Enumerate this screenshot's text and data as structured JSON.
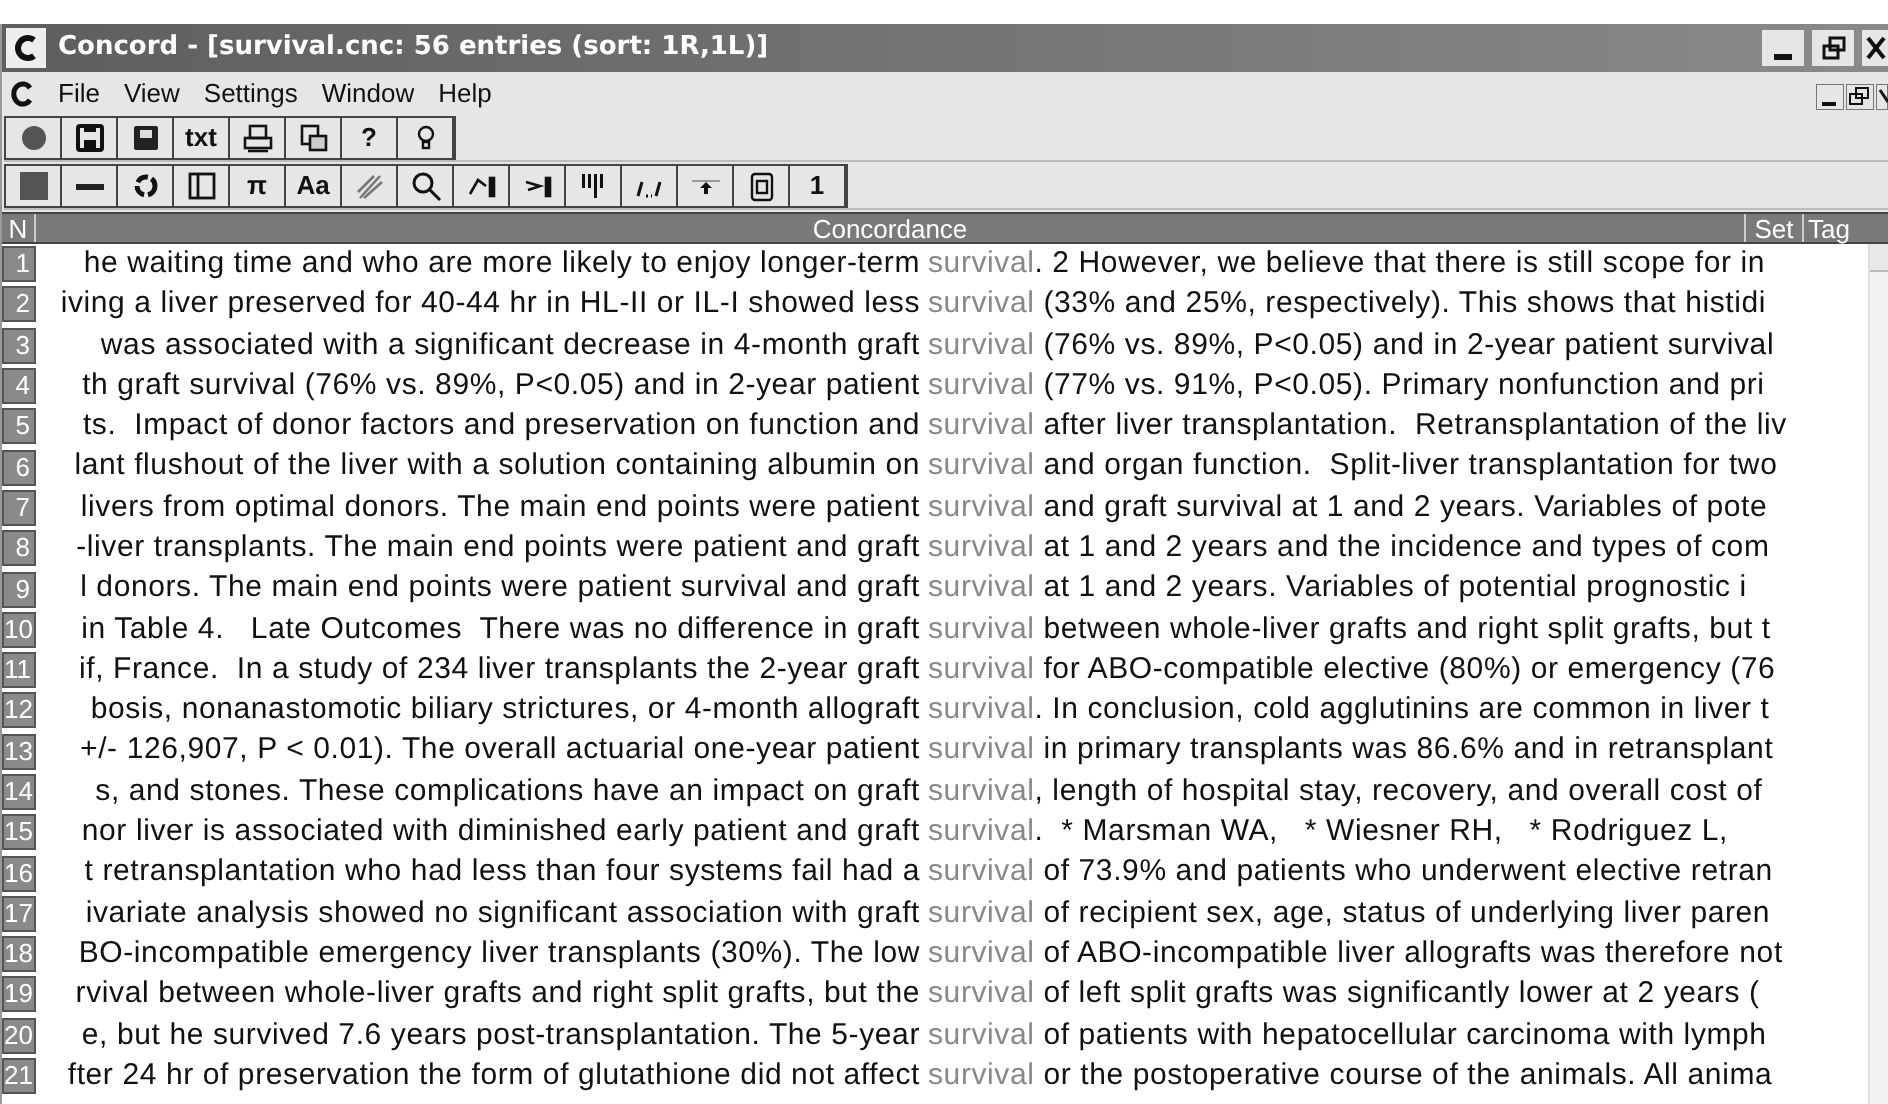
{
  "window": {
    "title": "Concord - [survival.cnc: 56 entries (sort: 1R,1L)]"
  },
  "menu": [
    "File",
    "View",
    "Settings",
    "Window",
    "Help"
  ],
  "toolbar_1": [
    {
      "kind": "icon"
    },
    {
      "kind": "icon"
    },
    {
      "kind": "icon"
    },
    {
      "kind": "glyph",
      "label": "txt"
    },
    {
      "kind": "icon"
    },
    {
      "kind": "icon"
    },
    {
      "kind": "glyph",
      "label": "?"
    },
    {
      "kind": "icon"
    }
  ],
  "toolbar_2": [
    {
      "kind": "icon"
    },
    {
      "kind": "icon"
    },
    {
      "kind": "icon"
    },
    {
      "kind": "icon"
    },
    {
      "kind": "glyph",
      "label": "π"
    },
    {
      "kind": "glyph",
      "label": "Aa"
    },
    {
      "kind": "icon"
    },
    {
      "kind": "icon"
    },
    {
      "kind": "icon"
    },
    {
      "kind": "icon"
    },
    {
      "kind": "icon"
    },
    {
      "kind": "icon"
    },
    {
      "kind": "icon"
    },
    {
      "kind": "icon"
    },
    {
      "kind": "glyph",
      "label": "1"
    }
  ],
  "table": {
    "columns": [
      "N",
      "Concordance",
      "Set",
      "Tag"
    ],
    "rows": [
      {
        "n": "1",
        "left": "he waiting time and who are more likely to enjoy longer-term",
        "keyword": "survival",
        "right": ". 2 However, we believe that there is still scope for in"
      },
      {
        "n": "2",
        "left": "iving a liver preserved for 40-44 hr in HL-II or IL-I showed less",
        "keyword": "survival",
        "right": " (33% and 25%, respectively). This shows that histidi"
      },
      {
        "n": "3",
        "left": " was associated with a significant decrease in 4-month graft",
        "keyword": "survival",
        "right": " (76% vs. 89%, P<0.05) and in 2-year patient survival"
      },
      {
        "n": "4",
        "left": "th graft survival (76% vs. 89%, P<0.05) and in 2-year patient",
        "keyword": "survival",
        "right": " (77% vs. 91%, P<0.05). Primary nonfunction and pri"
      },
      {
        "n": "5",
        "left": "ts.  Impact of donor factors and preservation on function and",
        "keyword": "survival",
        "right": " after liver transplantation.  Retransplantation of the liv"
      },
      {
        "n": "6",
        "left": "lant flushout of the liver with a solution containing albumin on",
        "keyword": "survival",
        "right": " and organ function.  Split-liver transplantation for two"
      },
      {
        "n": "7",
        "left": "livers from optimal donors. The main end points were patient",
        "keyword": "survival",
        "right": " and graft survival at 1 and 2 years. Variables of pote"
      },
      {
        "n": "8",
        "left": "-liver transplants. The main end points were patient and graft",
        "keyword": "survival",
        "right": " at 1 and 2 years and the incidence and types of com"
      },
      {
        "n": "9",
        "left": " l donors. The main end points were patient survival and graft",
        "keyword": "survival",
        "right": " at 1 and 2 years. Variables of potential prognostic i"
      },
      {
        "n": "10",
        "left": "in Table 4.   Late Outcomes  There was no difference in graft",
        "keyword": "survival",
        "right": " between whole-liver grafts and right split grafts, but t"
      },
      {
        "n": "11",
        "left": "if, France.  In a study of 234 liver transplants the 2-year graft",
        "keyword": "survival",
        "right": " for ABO-compatible elective (80%) or emergency (76"
      },
      {
        "n": "12",
        "left": "bosis, nonanastomotic biliary strictures, or 4-month allograft",
        "keyword": "survival",
        "right": ". In conclusion, cold agglutinins are common in liver t"
      },
      {
        "n": "13",
        "left": "+/- 126,907, P < 0.01). The overall actuarial one-year patient",
        "keyword": "survival",
        "right": " in primary transplants was 86.6% and in retransplant"
      },
      {
        "n": "14",
        "left": " s, and stones. These complications have an impact on graft",
        "keyword": "survival",
        "right": ", length of hospital stay, recovery, and overall cost of"
      },
      {
        "n": "15",
        "left": "nor liver is associated with diminished early patient and graft",
        "keyword": "survival",
        "right": ".  * Marsman WA,   * Wiesner RH,   * Rodriguez L,"
      },
      {
        "n": "16",
        "left": "t retransplantation who had less than four systems fail had a",
        "keyword": "survival",
        "right": " of 73.9% and patients who underwent elective retran"
      },
      {
        "n": "17",
        "left": "ivariate analysis showed no significant association with graft",
        "keyword": "survival",
        "right": " of recipient sex, age, status of underlying liver paren"
      },
      {
        "n": "18",
        "left": "BO-incompatible emergency liver transplants (30%). The low",
        "keyword": "survival",
        "right": " of ABO-incompatible liver allografts was therefore not"
      },
      {
        "n": "19",
        "left": " rvival between whole-liver grafts and right split grafts, but the",
        "keyword": "survival",
        "right": " of left split grafts was significantly lower at 2 years ("
      },
      {
        "n": "20",
        "left": " e, but he survived 7.6 years post-transplantation. The 5-year",
        "keyword": "survival",
        "right": " of patients with hepatocellular carcinoma with lymph"
      },
      {
        "n": "21",
        "left": "fter 24 hr of preservation the form of glutathione did not affect",
        "keyword": "survival",
        "right": " or the postoperative course of the animals. All anima"
      }
    ]
  }
}
